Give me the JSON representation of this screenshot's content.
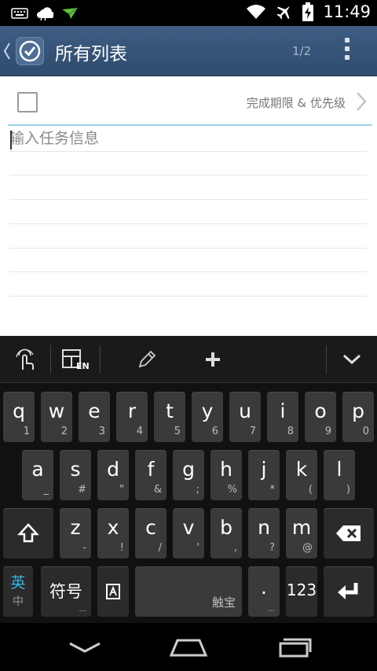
{
  "status_bar": {
    "time": "11:49",
    "icons": [
      "keyboard-icon",
      "weather-icon",
      "notification-icon",
      "wifi-icon",
      "airplane-mode-icon",
      "battery-charging-icon"
    ]
  },
  "action_bar": {
    "title": "所有列表",
    "page_indicator": "1/2",
    "icons": [
      "back-chevron-icon",
      "app-checkmark-icon",
      "overflow-menu-icon"
    ]
  },
  "task": {
    "due_priority_label": "完成期限 & 优先级",
    "input_placeholder": "输入任务信息",
    "input_value": ""
  },
  "keyboard_toolbar": {
    "icons": [
      "gesture-input-icon",
      "layout-switch-icon",
      "handwriting-pen-icon",
      "plus-icon",
      "hide-keyboard-icon"
    ],
    "layout_label": "EN"
  },
  "keyboard": {
    "row1": [
      {
        "key": "q",
        "alt": "1"
      },
      {
        "key": "w",
        "alt": "2"
      },
      {
        "key": "e",
        "alt": "3"
      },
      {
        "key": "r",
        "alt": "4"
      },
      {
        "key": "t",
        "alt": "5"
      },
      {
        "key": "y",
        "alt": "6"
      },
      {
        "key": "u",
        "alt": "7"
      },
      {
        "key": "i",
        "alt": "8"
      },
      {
        "key": "o",
        "alt": "9"
      },
      {
        "key": "p",
        "alt": "0"
      }
    ],
    "row2": [
      {
        "key": "a",
        "alt": "_"
      },
      {
        "key": "s",
        "alt": "#"
      },
      {
        "key": "d",
        "alt": "\""
      },
      {
        "key": "f",
        "alt": "&"
      },
      {
        "key": "g",
        "alt": ";"
      },
      {
        "key": "h",
        "alt": "%"
      },
      {
        "key": "j",
        "alt": "*"
      },
      {
        "key": "k",
        "alt": "("
      },
      {
        "key": "l",
        "alt": ")"
      }
    ],
    "row3": [
      {
        "key": "z",
        "alt": "-"
      },
      {
        "key": "x",
        "alt": "!"
      },
      {
        "key": "c",
        "alt": "/"
      },
      {
        "key": "v",
        "alt": "'"
      },
      {
        "key": "b",
        "alt": ","
      },
      {
        "key": "n",
        "alt": "?"
      },
      {
        "key": "m",
        "alt": "@"
      }
    ],
    "lang_main": "英",
    "lang_sub": "中",
    "symbols": "符号",
    "space_label": "触宝",
    "period": ".",
    "numbers": "123",
    "keys_icons": [
      "shift-icon",
      "backspace-icon",
      "text-input-icon",
      "enter-icon"
    ]
  },
  "nav_bar": {
    "icons": [
      "nav-back-icon",
      "nav-home-icon",
      "nav-recents-icon"
    ]
  }
}
